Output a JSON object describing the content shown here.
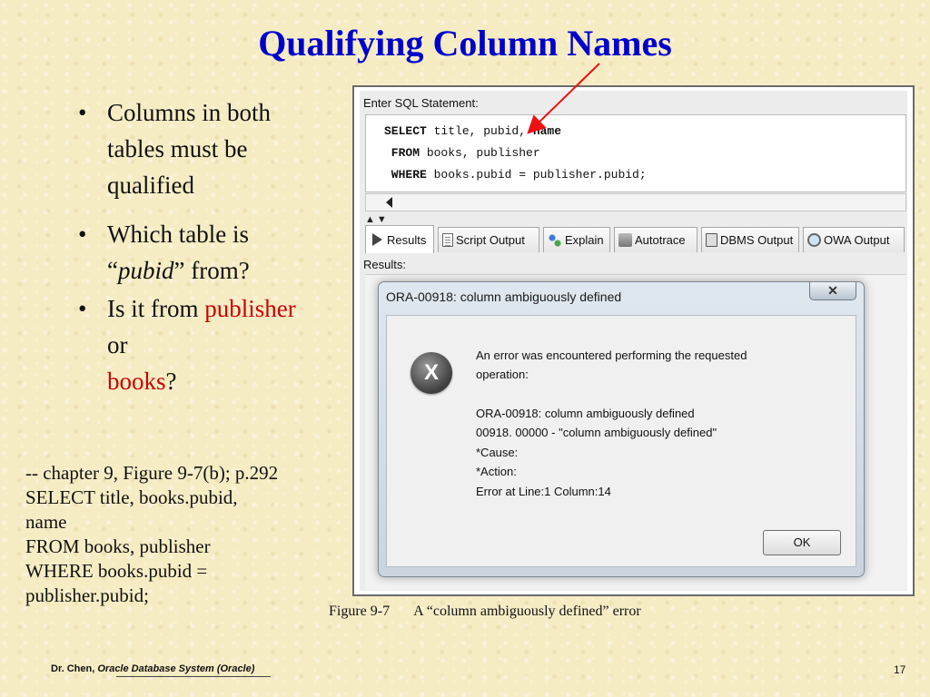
{
  "slide": {
    "title": "Qualifying Column Names",
    "bullets": {
      "b1": "Columns in both tables must be qualified",
      "b2_prefix": "Which table  is “",
      "b2_italic": "pubid",
      "b2_suffix": "” from?",
      "b3_prefix": "Is it from ",
      "b3_red1": "publisher",
      "b3_mid": " or ",
      "b3_red2": "books",
      "b3_suffix": "?"
    },
    "sql_lines": [
      "-- chapter 9, Figure 9-7(b); p.292",
      "SELECT title, books.pubid,",
      "name",
      "FROM books, publisher",
      "WHERE books.pubid =",
      "publisher.pubid;"
    ],
    "caption_figure": "Figure 9-7",
    "caption_text": "A “column ambiguously defined” error",
    "footer_author": "Dr. Chen,",
    "footer_course": "Oracle Database System (Oracle)",
    "page_number": "17"
  },
  "screenshot": {
    "sql_label": "Enter SQL Statement:",
    "sql": {
      "l1_kw": "SELECT",
      "l1_mid": " title, pubid,",
      "l1_kw2": " name",
      "l2_kw": " FROM",
      "l2_rest": " books, publisher",
      "l3_kw": " WHERE",
      "l3_rest": " books.pubid = publisher.pubid;"
    },
    "tabs": [
      "Results",
      "Script Output",
      "Explain",
      "Autotrace",
      "DBMS Output",
      "OWA Output"
    ],
    "results_label": "Results:"
  },
  "dialog": {
    "title": "ORA-00918: column ambiguously defined",
    "close_symbol": "✕",
    "icon_glyph": "X",
    "messages": [
      "An error was encountered performing the requested",
      "operation:",
      "ORA-00918: column ambiguously defined",
      "00918. 00000 -  \"column ambiguously defined\"",
      "*Cause:",
      "*Action:",
      "Error at Line:1 Column:14"
    ],
    "ok_label": "OK"
  },
  "colors": {
    "title": "#0000cc",
    "highlight": "#cc0000",
    "arrow": "#ee1111",
    "background": "#f6ecc4"
  }
}
